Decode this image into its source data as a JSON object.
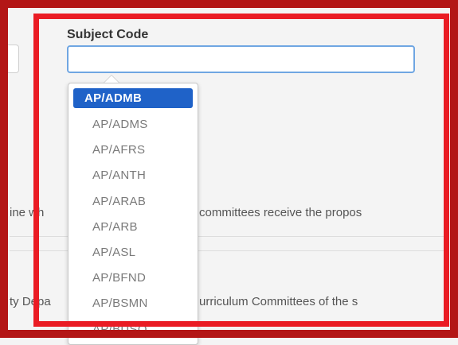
{
  "form": {
    "subject_code_label": "Subject Code",
    "subject_code_value": ""
  },
  "dropdown": {
    "selected": "AP/ADMB",
    "options": [
      "AP/ADMB",
      "AP/ADMS",
      "AP/AFRS",
      "AP/ANTH",
      "AP/ARAB",
      "AP/ARB",
      "AP/ASL",
      "AP/BFND",
      "AP/BSMN",
      "AP/BUSO"
    ]
  },
  "background": {
    "text_1_left": "ine wh",
    "text_1_right": "committees receive the propos",
    "text_2_left": "ty Depa",
    "text_2_right": "urriculum Committees of the s"
  },
  "colors": {
    "outer_frame": "#b31616",
    "inner_frame": "#ea1c24",
    "selected_option_bg": "#1f62c8",
    "input_border": "#6fa6e2"
  }
}
